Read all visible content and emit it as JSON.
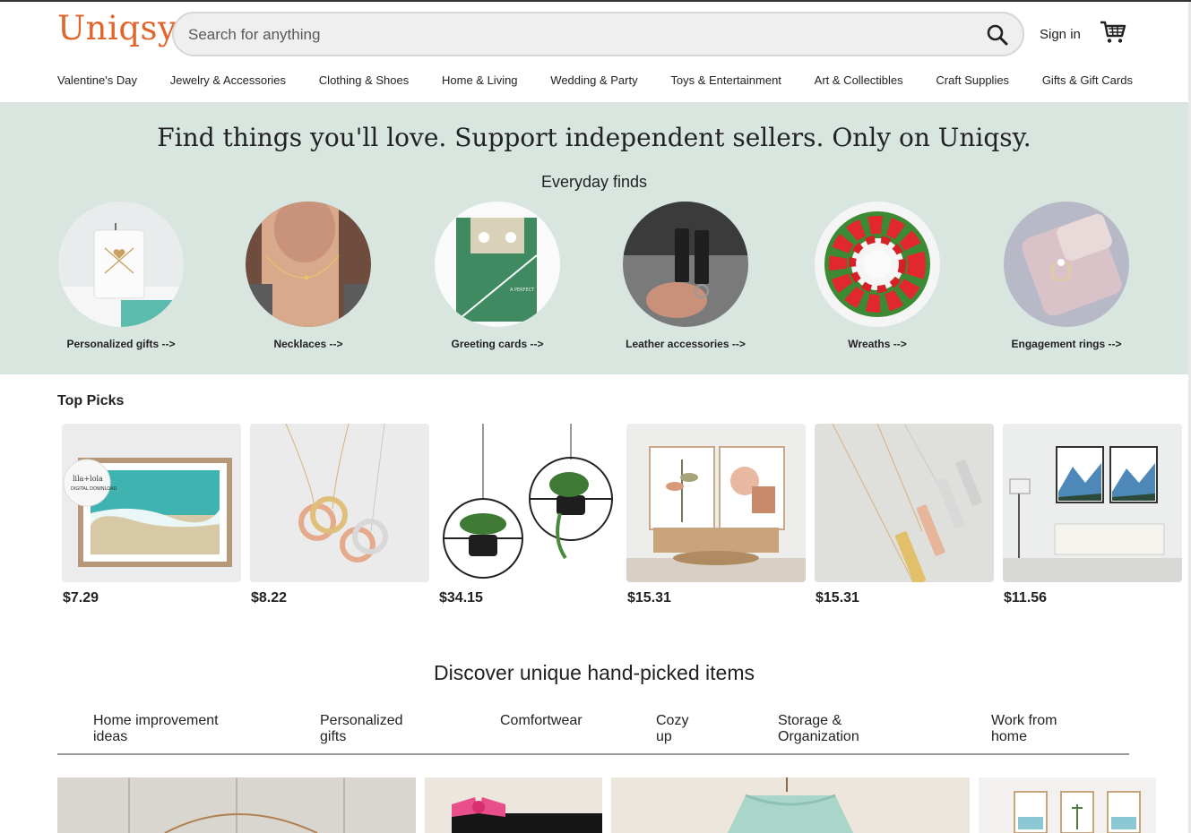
{
  "header": {
    "logo": "Uniqsy",
    "search_placeholder": "Search for anything",
    "sign_in": "Sign in"
  },
  "categories": [
    "Valentine's Day",
    "Jewelry & Accessories",
    "Clothing & Shoes",
    "Home & Living",
    "Wedding & Party",
    "Toys & Entertainment",
    "Art & Collectibles",
    "Craft Supplies",
    "Gifts & Gift Cards"
  ],
  "hero": {
    "title": "Find things you'll love. Support independent sellers. Only on Uniqsy.",
    "subtitle": "Everyday finds",
    "finds": [
      {
        "label": "Personalized gifts -->",
        "image": "candle-photo"
      },
      {
        "label": "Necklaces -->",
        "image": "necklace-photo"
      },
      {
        "label": "Greeting cards -->",
        "image": "card-photo"
      },
      {
        "label": "Leather accessories -->",
        "image": "keychain-photo"
      },
      {
        "label": "Wreaths -->",
        "image": "wreath-photo"
      },
      {
        "label": "Engagement rings -->",
        "image": "ring-photo"
      }
    ]
  },
  "top_picks": {
    "title": "Top Picks",
    "items": [
      {
        "price": "$7.29",
        "image": "beach-print-photo",
        "badge_line1": "lila+lola",
        "badge_line2": "DIGITAL DOWNLOAD"
      },
      {
        "price": "$8.22",
        "image": "ring-necklace-photo"
      },
      {
        "price": "$34.15",
        "image": "hanging-planters-photo"
      },
      {
        "price": "$15.31",
        "image": "boho-prints-photo"
      },
      {
        "price": "$15.31",
        "image": "bar-necklace-photo"
      },
      {
        "price": "$11.56",
        "image": "mountain-prints-photo"
      }
    ]
  },
  "discover": {
    "title": "Discover unique hand-picked items",
    "tabs": [
      {
        "line1": "Home improvement",
        "line2": "ideas"
      },
      {
        "line1": "Personalized",
        "line2": "gifts"
      },
      {
        "line1": "Comfortwear",
        "line2": ""
      },
      {
        "line1": "Cozy",
        "line2": "up"
      },
      {
        "line1": "Storage &",
        "line2": "Organization"
      },
      {
        "line1": "Work from",
        "line2": "home"
      }
    ]
  },
  "colors": {
    "brand": "#e0662c",
    "hero_bg": "#d8e6df"
  },
  "icons": {
    "search": "search-icon",
    "cart": "cart-icon"
  }
}
